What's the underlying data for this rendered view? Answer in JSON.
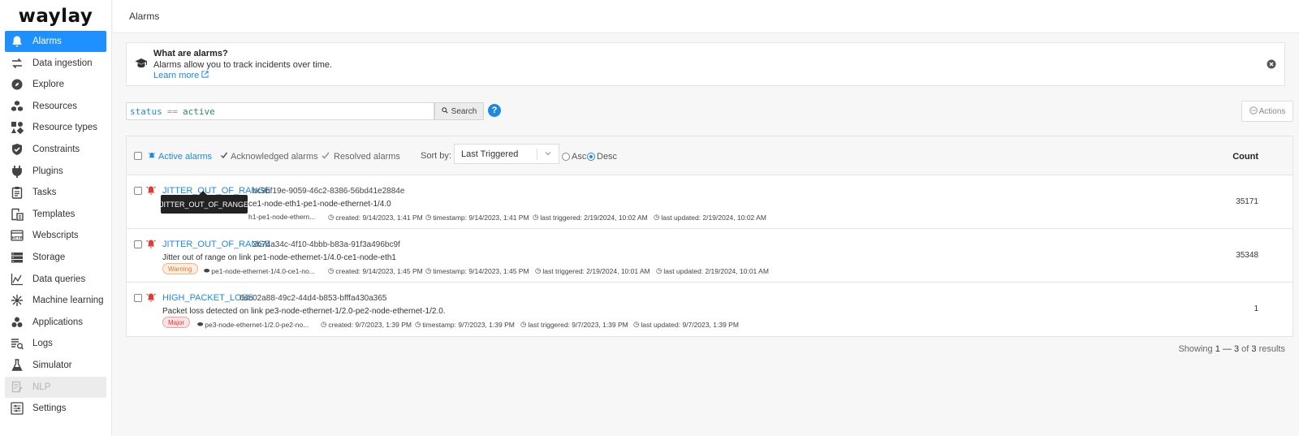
{
  "app": {
    "logo": "waylay"
  },
  "sidebar": {
    "items": [
      {
        "label": "Alarms",
        "icon": "bell-icon",
        "state": "active"
      },
      {
        "label": "Data ingestion",
        "icon": "arrows-exchange-icon",
        "state": "normal"
      },
      {
        "label": "Explore",
        "icon": "compass-icon",
        "state": "normal"
      },
      {
        "label": "Resources",
        "icon": "cubes-icon",
        "state": "normal"
      },
      {
        "label": "Resource types",
        "icon": "shapes-icon",
        "state": "normal"
      },
      {
        "label": "Constraints",
        "icon": "shield-check-icon",
        "state": "normal"
      },
      {
        "label": "Plugins",
        "icon": "plug-icon",
        "state": "normal"
      },
      {
        "label": "Tasks",
        "icon": "clipboard-icon",
        "state": "normal"
      },
      {
        "label": "Templates",
        "icon": "template-icon",
        "state": "normal"
      },
      {
        "label": "Webscripts",
        "icon": "http-icon",
        "state": "normal"
      },
      {
        "label": "Storage",
        "icon": "storage-icon",
        "state": "normal"
      },
      {
        "label": "Data queries",
        "icon": "chart-query-icon",
        "state": "normal"
      },
      {
        "label": "Machine learning",
        "icon": "ml-icon",
        "state": "normal"
      },
      {
        "label": "Applications",
        "icon": "apps-icon",
        "state": "normal"
      },
      {
        "label": "Logs",
        "icon": "logs-icon",
        "state": "normal"
      },
      {
        "label": "Simulator",
        "icon": "flask-icon",
        "state": "normal"
      },
      {
        "label": "NLP",
        "icon": "nlp-doc-icon",
        "state": "disabled"
      },
      {
        "label": "Settings",
        "icon": "settings-sliders-icon",
        "state": "normal"
      }
    ]
  },
  "header": {
    "title": "Alarms"
  },
  "info": {
    "title": "What are alarms?",
    "description": "Alarms allow you to track incidents over time.",
    "link_label": "Learn more"
  },
  "search": {
    "query_key": "status",
    "query_op": "==",
    "query_value": "active",
    "button_label": "Search",
    "help_label": "?"
  },
  "actions": {
    "label": "Actions"
  },
  "table": {
    "tabs": [
      {
        "label": "Active alarms",
        "active": true
      },
      {
        "label": "Acknowledged alarms",
        "active": false
      },
      {
        "label": "Resolved alarms",
        "active": false
      }
    ],
    "sort_label": "Sort by:",
    "sort_value": "Last Triggered",
    "order_asc": "Asc",
    "order_desc": "Desc",
    "order_selected": "Desc",
    "count_header": "Count",
    "rows": [
      {
        "name": "JITTER_OUT_OF_RANGE",
        "id": "bc9bf19e-9059-46c2-8386-56bd41e2884e",
        "description": "ce1-node-eth1-pe1-node-ethernet-1/4.0",
        "severity": "",
        "resource": "h1-pe1-node-ethern...",
        "created": "created: 9/14/2023, 1:41 PM",
        "timestamp": "timestamp: 9/14/2023, 1:41 PM",
        "last_triggered": "last triggered: 2/19/2024, 10:02 AM",
        "last_updated": "last updated: 2/19/2024, 10:02 AM",
        "count": "35171"
      },
      {
        "name": "JITTER_OUT_OF_RANGE",
        "id": "2b74a34c-4f10-4bbb-b83a-91f3a496bc9f",
        "description": "Jitter out of range on link pe1-node-ethernet-1/4.0-ce1-node-eth1",
        "severity": "Warning",
        "resource": "pe1-node-ethernet-1/4.0-ce1-no...",
        "created": "created: 9/14/2023, 1:45 PM",
        "timestamp": "timestamp: 9/14/2023, 1:45 PM",
        "last_triggered": "last triggered: 2/19/2024, 10:01 AM",
        "last_updated": "last updated: 2/19/2024, 10:01 AM",
        "count": "35348"
      },
      {
        "name": "HIGH_PACKET_LOSS",
        "id": "6dc02a88-49c2-44d4-b853-bfffa430a365",
        "description": "Packet loss detected on link pe3-node-ethernet-1/2.0-pe2-node-ethernet-1/2.0.",
        "severity": "Major",
        "resource": "pe3-node-ethernet-1/2.0-pe2-no...",
        "created": "created: 9/7/2023, 1:39 PM",
        "timestamp": "timestamp: 9/7/2023, 1:39 PM",
        "last_triggered": "last triggered: 9/7/2023, 1:39 PM",
        "last_updated": "last updated: 9/7/2023, 1:39 PM",
        "count": "1"
      }
    ]
  },
  "tooltip": {
    "text": "JITTER_OUT_OF_RANGE"
  },
  "footer": {
    "showing_prefix": "Showing",
    "range": "1 — 3",
    "of_label": "of",
    "total": "3",
    "suffix": "results"
  },
  "colors": {
    "accent": "#1e90ff",
    "link": "#1e88e5",
    "alarm_red": "#e53935"
  }
}
